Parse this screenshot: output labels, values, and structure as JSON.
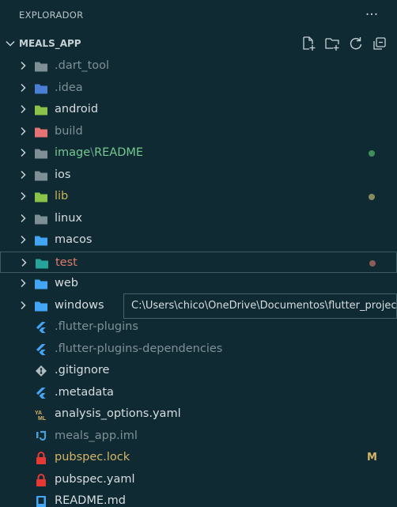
{
  "panel": {
    "title": "EXPLORADOR",
    "more": "···"
  },
  "section": {
    "title": "MEALS_APP"
  },
  "items": [
    {
      "label": ".dart_tool",
      "kind": "folder",
      "color": "#7f9096",
      "icon": "folder-icon",
      "iconColor": "#7e8f95"
    },
    {
      "label": ".idea",
      "kind": "folder",
      "color": "#7f9096",
      "icon": "folder-idea-icon",
      "iconColor": "#4a7fd6"
    },
    {
      "label": "android",
      "kind": "folder",
      "color": "#d7dde0",
      "icon": "folder-android-icon",
      "iconColor": "#8bc34a"
    },
    {
      "label": "build",
      "kind": "folder",
      "color": "#7f9096",
      "icon": "folder-build-icon",
      "iconColor": "#e57373"
    },
    {
      "label": "image",
      "sublabel": "README",
      "kind": "folder",
      "color": "#73c991",
      "icon": "folder-images-icon",
      "iconColor": "#7e8f95",
      "dot": "#3f8f5a"
    },
    {
      "label": "ios",
      "kind": "folder",
      "color": "#d7dde0",
      "icon": "folder-ios-icon",
      "iconColor": "#7e8f95"
    },
    {
      "label": "lib",
      "kind": "folder",
      "color": "#c9b458",
      "icon": "folder-lib-icon",
      "iconColor": "#8bc34a",
      "dot": "#8a8a60"
    },
    {
      "label": "linux",
      "kind": "folder",
      "color": "#d7dde0",
      "icon": "folder-linux-icon",
      "iconColor": "#7e8f95"
    },
    {
      "label": "macos",
      "kind": "folder",
      "color": "#d7dde0",
      "icon": "folder-macos-icon",
      "iconColor": "#42a5f5"
    },
    {
      "label": "test",
      "kind": "folder",
      "color": "#e07a6a",
      "icon": "folder-test-icon",
      "iconColor": "#26a69a",
      "dot": "#8a5e58",
      "selected": true
    },
    {
      "label": "web",
      "kind": "folder",
      "color": "#d7dde0",
      "icon": "folder-web-icon",
      "iconColor": "#42a5f5"
    },
    {
      "label": "windows",
      "kind": "folder",
      "color": "#d7dde0",
      "icon": "folder-windows-icon",
      "iconColor": "#42a5f5"
    },
    {
      "label": ".flutter-plugins",
      "kind": "file",
      "color": "#7f9096",
      "icon": "flutter-icon",
      "iconColor": "#42a5f5"
    },
    {
      "label": ".flutter-plugins-dependencies",
      "kind": "file",
      "color": "#7f9096",
      "icon": "flutter-icon",
      "iconColor": "#42a5f5"
    },
    {
      "label": ".gitignore",
      "kind": "file",
      "color": "#d7dde0",
      "icon": "git-icon",
      "iconColor": "#b0bcc0"
    },
    {
      "label": ".metadata",
      "kind": "file",
      "color": "#d7dde0",
      "icon": "flutter-icon",
      "iconColor": "#42a5f5"
    },
    {
      "label": "analysis_options.yaml",
      "kind": "file",
      "color": "#d7dde0",
      "icon": "yaml-icon",
      "iconColor": "#d6b566"
    },
    {
      "label": "meals_app.iml",
      "kind": "file",
      "color": "#7f9096",
      "icon": "intellij-icon",
      "iconColor": "#4a9fd6"
    },
    {
      "label": "pubspec.lock",
      "kind": "file",
      "color": "#d6b566",
      "icon": "lock-icon",
      "iconColor": "#e53935",
      "status": "M"
    },
    {
      "label": "pubspec.yaml",
      "kind": "file",
      "color": "#d7dde0",
      "icon": "lock-icon",
      "iconColor": "#e53935"
    },
    {
      "label": "README.md",
      "kind": "file",
      "color": "#d7dde0",
      "icon": "readme-icon",
      "iconColor": "#42a5f5"
    }
  ],
  "tooltip": {
    "text": "C:\\Users\\chico\\OneDrive\\Documentos\\flutter_projects\\meals_app\\windows"
  }
}
